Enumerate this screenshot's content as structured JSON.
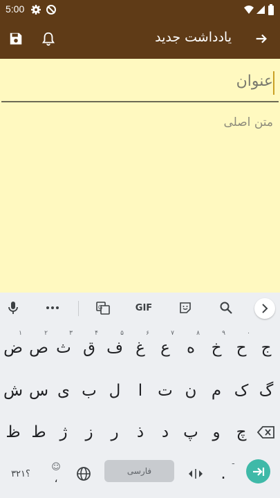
{
  "status": {
    "time": "5:00"
  },
  "appbar": {
    "title": "یادداشت جدید"
  },
  "editor": {
    "title_placeholder": "عنوان",
    "body_placeholder": "متن اصلی"
  },
  "keyboard": {
    "toolbar": [
      "mic-icon",
      "more-icon",
      "translate-icon",
      "GIF",
      "sticker-icon",
      "search-icon",
      "chevron-right-icon"
    ],
    "gif_label": "GIF",
    "row1": [
      {
        "char": "ض",
        "hint": "۱"
      },
      {
        "char": "ص",
        "hint": "۲"
      },
      {
        "char": "ث",
        "hint": "۳"
      },
      {
        "char": "ق",
        "hint": "۴"
      },
      {
        "char": "ف",
        "hint": "۵"
      },
      {
        "char": "غ",
        "hint": "۶"
      },
      {
        "char": "ع",
        "hint": "۷"
      },
      {
        "char": "ه",
        "hint": "۸"
      },
      {
        "char": "خ",
        "hint": "۹"
      },
      {
        "char": "ح",
        "hint": "۰"
      },
      {
        "char": "ج",
        "hint": ""
      }
    ],
    "row2": [
      "ش",
      "س",
      "ی",
      "ب",
      "ل",
      "ا",
      "ت",
      "ن",
      "م",
      "ک",
      "گ"
    ],
    "row3": [
      "ظ",
      "ط",
      "ژ",
      "ز",
      "ر",
      "ذ",
      "د",
      "پ",
      "و",
      "چ"
    ],
    "row4": {
      "symbols": "؟۳۲۱",
      "comma": "،",
      "space": "فارسی",
      "period": "."
    }
  }
}
